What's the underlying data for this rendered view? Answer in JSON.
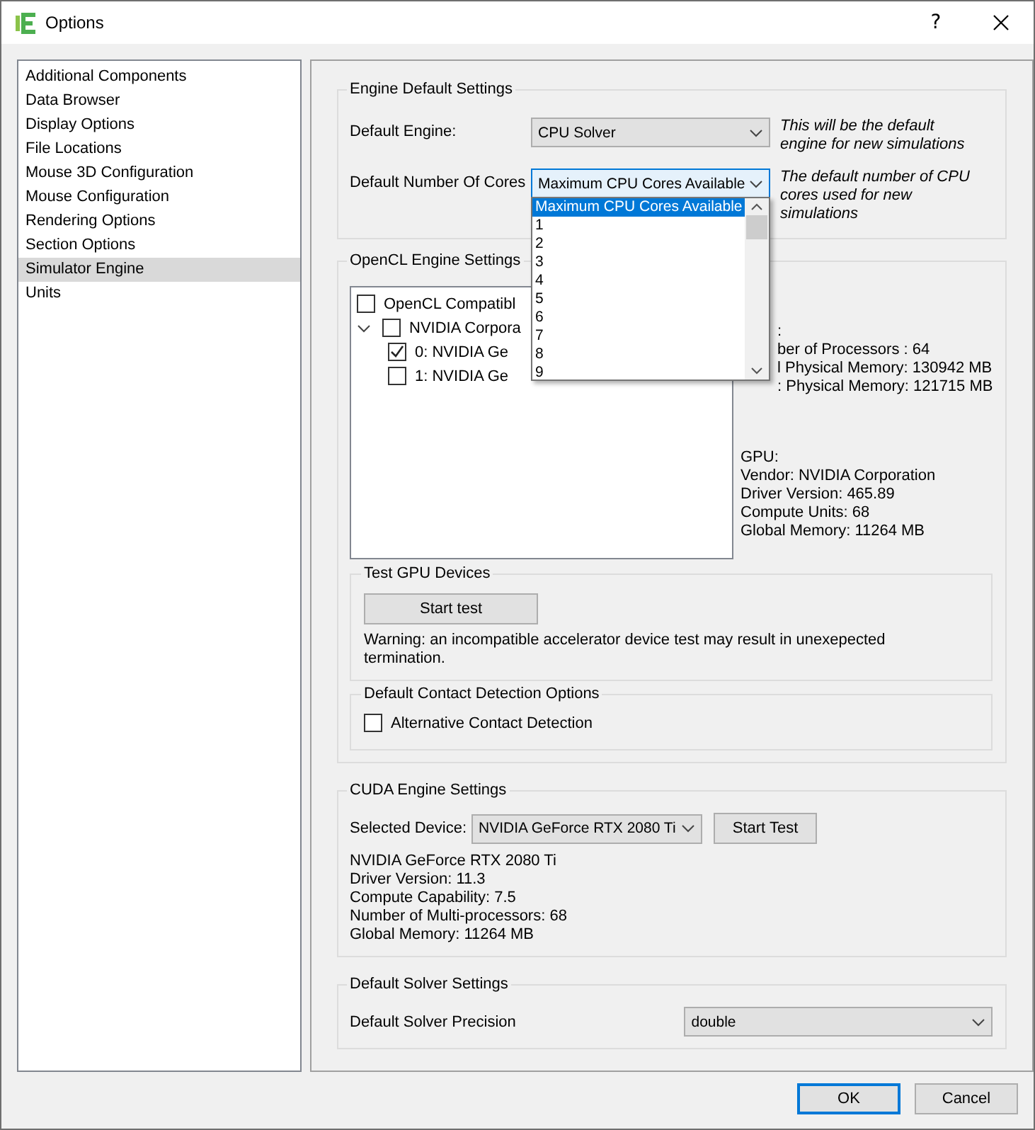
{
  "window": {
    "title": "Options",
    "help": "?"
  },
  "sidebar": {
    "items": [
      {
        "label": "Additional Components",
        "selected": false
      },
      {
        "label": "Data Browser",
        "selected": false
      },
      {
        "label": "Display Options",
        "selected": false
      },
      {
        "label": "File Locations",
        "selected": false
      },
      {
        "label": "Mouse 3D Configuration",
        "selected": false
      },
      {
        "label": "Mouse Configuration",
        "selected": false
      },
      {
        "label": "Rendering Options",
        "selected": false
      },
      {
        "label": "Section Options",
        "selected": false
      },
      {
        "label": "Simulator Engine",
        "selected": true
      },
      {
        "label": "Units",
        "selected": false
      }
    ]
  },
  "engine_defaults": {
    "title": "Engine Default Settings",
    "rows": [
      {
        "label": "Default Engine:",
        "value": "CPU Solver",
        "note": "This will be the default engine for new simulations",
        "focused": false
      },
      {
        "label": "Default Number Of Cores",
        "value": "Maximum CPU Cores Available",
        "note": "The default number of CPU cores used for new simulations",
        "focused": true
      }
    ],
    "cores_dropdown": {
      "options": [
        {
          "label": "Maximum CPU Cores Available",
          "selected": true
        },
        {
          "label": "1",
          "selected": false
        },
        {
          "label": "2",
          "selected": false
        },
        {
          "label": "3",
          "selected": false
        },
        {
          "label": "4",
          "selected": false
        },
        {
          "label": "5",
          "selected": false
        },
        {
          "label": "6",
          "selected": false
        },
        {
          "label": "7",
          "selected": false
        },
        {
          "label": "8",
          "selected": false
        },
        {
          "label": "9",
          "selected": false
        }
      ]
    }
  },
  "opencl": {
    "title": "OpenCL Engine Settings",
    "tree": [
      {
        "label": "OpenCL Compatibl",
        "checked": false
      },
      {
        "label": "NVIDIA Corpora",
        "checked": false,
        "expanded": true,
        "children": [
          {
            "label": "0: NVIDIA Ge",
            "checked": true
          },
          {
            "label": "1: NVIDIA Ge",
            "checked": false
          }
        ]
      }
    ],
    "cpu_info": [
      ":",
      "ber of Processors : 64",
      "l Physical Memory: 130942 MB",
      ": Physical Memory: 121715 MB"
    ],
    "gpu_info": [
      "GPU:",
      "Vendor: NVIDIA Corporation",
      "Driver Version: 465.89",
      "Compute Units: 68",
      "Global Memory: 11264 MB"
    ],
    "test_gpu": {
      "title": "Test GPU Devices",
      "button": "Start test",
      "warning": "Warning: an incompatible accelerator device test may result in unexepected termination."
    },
    "contact": {
      "title": "Default Contact Detection Options",
      "option": {
        "label": "Alternative Contact Detection",
        "checked": false
      }
    }
  },
  "cuda": {
    "title": "CUDA Engine Settings",
    "device_label": "Selected Device:",
    "device": "NVIDIA GeForce RTX 2080 Ti",
    "button": "Start Test",
    "info": [
      "NVIDIA GeForce RTX 2080 Ti",
      "Driver Version: 11.3",
      "Compute Capability: 7.5",
      "Number of Multi-processors: 68",
      "Global Memory: 11264 MB"
    ]
  },
  "solver": {
    "title": "Default Solver Settings",
    "label": "Default Solver Precision",
    "value": "double"
  },
  "buttons": [
    {
      "label": "OK",
      "default": true
    },
    {
      "label": "Cancel",
      "default": false
    }
  ]
}
